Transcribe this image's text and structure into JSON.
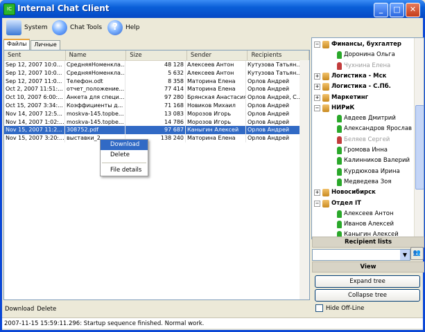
{
  "window": {
    "title": "Internal Chat Client",
    "min": "_",
    "max": "□",
    "close": "✕"
  },
  "toolbar": {
    "system": "System",
    "chat_tools": "Chat Tools",
    "help": "Help"
  },
  "tabs": [
    "Файлы",
    "Личные"
  ],
  "table": {
    "headers": [
      "Sent",
      "Name",
      "Size",
      "Sender",
      "Recipients"
    ],
    "rows": [
      [
        "Sep 12, 2007 10:0...",
        "СредняяНоменкла...",
        "48 128",
        "Алексеев Антон",
        "Кутузова Татьян..."
      ],
      [
        "Sep 12, 2007 10:0...",
        "СредняяНоменкла...",
        "5 632",
        "Алексеев Антон",
        "Кутузова Татьян..."
      ],
      [
        "Sep 12, 2007 11:0...",
        "Телефон.odt",
        "8 358",
        "Маторина Елена",
        "Орлов Андрей"
      ],
      [
        "Oct 2, 2007 11:51:...",
        "отчет_положение...",
        "77 414",
        "Маторина Елена",
        "Орлов Андрей"
      ],
      [
        "Oct 10, 2007 6:00:...",
        "Анкета для специ...",
        "97 280",
        "Брянская Анастасия",
        "Орлов Андрей, С..."
      ],
      [
        "Oct 15, 2007 3:34:...",
        "Коэффициенты д...",
        "71 168",
        "Новиков Михаил",
        "Орлов Андрей"
      ],
      [
        "Nov 14, 2007 12:5...",
        "moskva-145.topbe...",
        "13 083",
        "Морозов Игорь",
        "Орлов Андрей"
      ],
      [
        "Nov 14, 2007 1:02:...",
        "moskva-145.topbe...",
        "14 786",
        "Морозов Игорь",
        "Орлов Андрей"
      ],
      [
        "Nov 15, 2007 11:2...",
        "308752.pdf",
        "97 687",
        "Каныгин Алексей",
        "Орлов Андрей"
      ],
      [
        "Nov 15, 2007 3:20:...",
        "выставки_2...",
        "138 240",
        "Маторина Елена",
        "Орлов Андрей"
      ]
    ],
    "selected_index": 8
  },
  "context_menu": {
    "download": "Download",
    "delete": "Delete",
    "details": "File details"
  },
  "actions": {
    "download": "Download",
    "delete": "Delete"
  },
  "tree": [
    {
      "label": "Финансы, бухгалтер",
      "type": "group",
      "expander": "−"
    },
    {
      "label": "Доронина Ольга",
      "type": "user",
      "color": "#2aa82a"
    },
    {
      "label": "Чухнина Елена",
      "type": "user-off",
      "color": "#c23b3b"
    },
    {
      "label": "Логистика - Мск",
      "type": "group",
      "expander": "+"
    },
    {
      "label": "Логистика - С.Пб.",
      "type": "group",
      "expander": "+"
    },
    {
      "label": "Маркетинг",
      "type": "group",
      "expander": "+"
    },
    {
      "label": "НИРиК",
      "type": "group",
      "expander": "−"
    },
    {
      "label": "Авдеев Дмитрий",
      "type": "user",
      "color": "#2aa82a"
    },
    {
      "label": "Александров Ярослав",
      "type": "user",
      "color": "#2aa82a"
    },
    {
      "label": "Беляев Сергей",
      "type": "user-off",
      "color": "#c23b3b"
    },
    {
      "label": "Громова Инна",
      "type": "user",
      "color": "#2aa82a"
    },
    {
      "label": "Калинников Валерий",
      "type": "user",
      "color": "#2aa82a"
    },
    {
      "label": "Курдюкова Ирина",
      "type": "user",
      "color": "#2aa82a"
    },
    {
      "label": "Медведева Зоя",
      "type": "user",
      "color": "#2aa82a"
    },
    {
      "label": "Новосибирск",
      "type": "group",
      "expander": "+"
    },
    {
      "label": "Отдел IT",
      "type": "group",
      "expander": "−"
    },
    {
      "label": "Алексеев Антон",
      "type": "user",
      "color": "#2aa82a"
    },
    {
      "label": "Иванов Алексей",
      "type": "user",
      "color": "#2aa82a"
    },
    {
      "label": "Каныгин Алексей",
      "type": "user",
      "color": "#2aa82a"
    }
  ],
  "recipient_lists": {
    "header": "Recipient lists",
    "combo_value": ""
  },
  "view": {
    "header": "View",
    "expand": "Expand tree",
    "collapse": "Collapse tree",
    "hide_offline": "Hide Off-Line"
  },
  "status": "2007-11-15 15:59:11.296: Startup sequence finished. Normal work."
}
